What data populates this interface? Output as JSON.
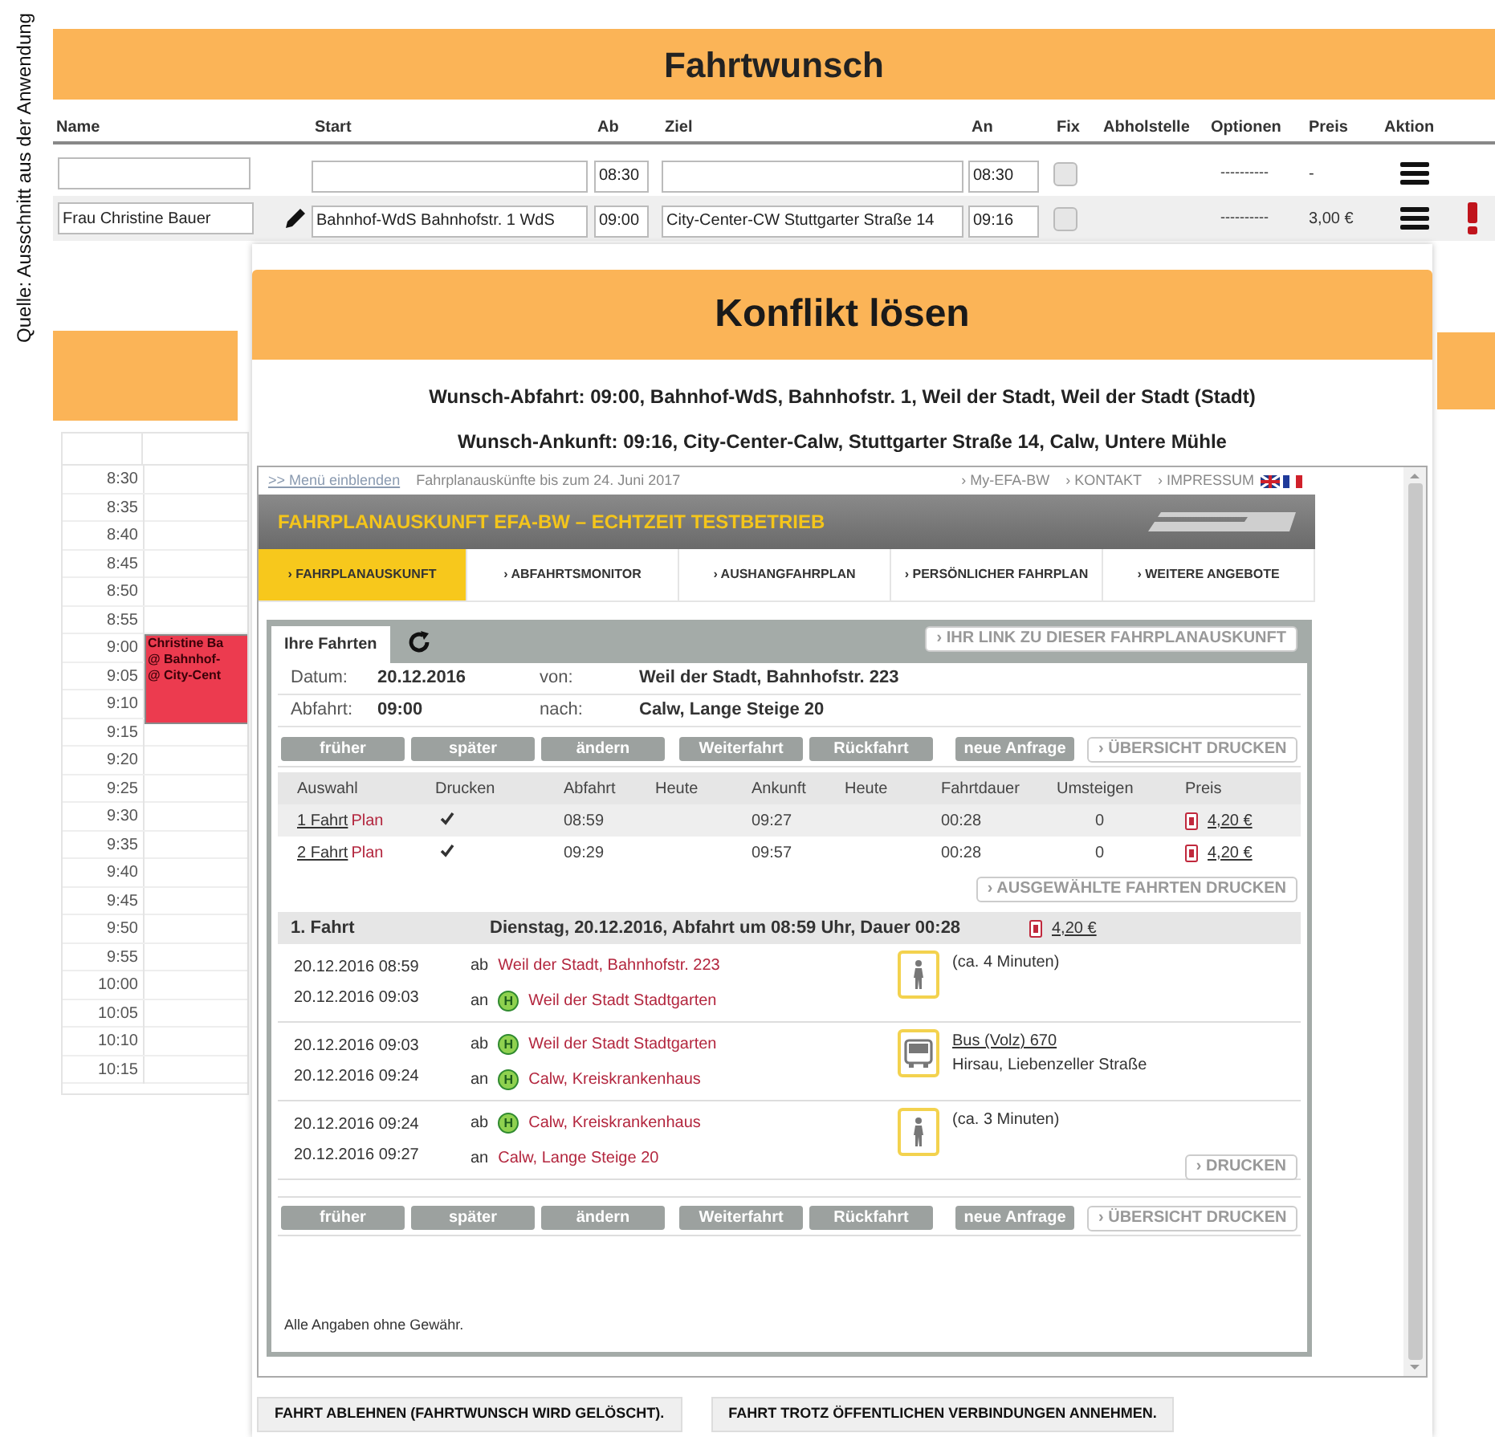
{
  "source_note": "Quelle: Ausschnitt aus der Anwendung",
  "request": {
    "title": "Fahrtwunsch",
    "columns": [
      "Name",
      "Start",
      "Ab",
      "Ziel",
      "An",
      "Fix",
      "Abholstelle",
      "Optionen",
      "Preis",
      "Aktion"
    ],
    "rows": [
      {
        "ab": "08:30",
        "an": "08:30",
        "fix": false,
        "options": "----------",
        "price": "-",
        "editable": false,
        "conflict": false
      },
      {
        "name": "Frau Christine Bauer",
        "start": "Bahnhof-WdS Bahnhofstr. 1 WdS",
        "ab": "09:00",
        "ziel": "City-Center-CW Stuttgarter Straße 14",
        "an": "09:16",
        "fix": false,
        "options": "----------",
        "price": "3,00 €",
        "editable": true,
        "conflict": true
      }
    ]
  },
  "calendar": {
    "slots": [
      {
        "time": "8:30"
      },
      {
        "time": "8:35"
      },
      {
        "time": "8:40"
      },
      {
        "time": "8:45"
      },
      {
        "time": "8:50"
      },
      {
        "time": "8:55"
      },
      {
        "time": "9:00",
        "event": {
          "lines": [
            "Christine Ba",
            "@ Bahnhof-",
            "@ City-Cent"
          ]
        }
      },
      {
        "time": "9:05"
      },
      {
        "time": "9:10"
      },
      {
        "time": "9:15"
      },
      {
        "time": "9:20"
      },
      {
        "time": "9:25"
      },
      {
        "time": "9:30"
      },
      {
        "time": "9:35"
      },
      {
        "time": "9:40"
      },
      {
        "time": "9:45"
      },
      {
        "time": "9:50"
      },
      {
        "time": "9:55"
      },
      {
        "time": "10:00"
      },
      {
        "time": "10:05"
      },
      {
        "time": "10:10"
      },
      {
        "time": "10:15"
      }
    ]
  },
  "dialog": {
    "title": "Konflikt lösen",
    "lines": [
      "Wunsch-Abfahrt: 09:00, Bahnhof-WdS, Bahnhofstr. 1, Weil der Stadt, Weil der Stadt (Stadt)",
      "Wunsch-Ankunft: 09:16, City-Center-Calw, Stuttgarter Straße 14, Calw, Untere Mühle"
    ],
    "efa": {
      "menu_link": ">> Menü einblenden",
      "notice": "Fahrplanauskünfte bis zum 24. Juni 2017",
      "top_links": [
        "› My-EFA-BW",
        "› KONTAKT",
        "› IMPRESSUM"
      ],
      "banner": "FAHRPLANAUSKUNFT EFA-BW – ECHTZEIT TESTBETRIEB",
      "nav": [
        {
          "label": "› FAHRPLANAUSKUNFT",
          "selected": true
        },
        {
          "label": "› ABFAHRTSMONITOR",
          "selected": false
        },
        {
          "label": "› AUSHANGFAHRPLAN",
          "selected": false
        },
        {
          "label": "› PERSÖNLICHER FAHRPLAN",
          "selected": false
        },
        {
          "label": "› WEITERE ANGEBOTE",
          "selected": false
        }
      ],
      "panel_tab": "Ihre Fahrten",
      "link_button": "› IHR LINK ZU DIESER FAHRPLANAUSKUNFT",
      "query": [
        {
          "label": "Datum:",
          "value": "20.12.2016",
          "label2": "von:",
          "value2": "Weil der Stadt, Bahnhofstr. 223"
        },
        {
          "label": "Abfahrt:",
          "value": "09:00",
          "label2": "nach:",
          "value2": "Calw, Lange Steige 20"
        }
      ],
      "toolbar_top": {
        "buttons": [
          "früher",
          "später",
          "ändern",
          "Weiterfahrt",
          "Rückfahrt",
          "neue Anfrage"
        ],
        "print": "› ÜBERSICHT DRUCKEN"
      },
      "results": {
        "columns": [
          "Auswahl",
          "Drucken",
          "Abfahrt",
          "Heute",
          "Ankunft",
          "Heute",
          "Fahrtdauer",
          "Umsteigen",
          "Preis"
        ],
        "rows": [
          {
            "trip": "1 Fahrt",
            "plan": "Plan",
            "print": true,
            "dep": "08:59",
            "arr": "09:27",
            "duration": "00:28",
            "changes": "0",
            "price": "4,20 €",
            "selected": true
          },
          {
            "trip": "2 Fahrt",
            "plan": "Plan",
            "print": true,
            "dep": "09:29",
            "arr": "09:57",
            "duration": "00:28",
            "changes": "0",
            "price": "4,20 €",
            "selected": false
          }
        ]
      },
      "print_selected": "› AUSGEWÄHLTE FAHRTEN DRUCKEN",
      "detail": {
        "title": "1. Fahrt",
        "summary": "Dienstag, 20.12.2016, Abfahrt um 08:59 Uhr, Dauer 00:28",
        "price": "4,20 €",
        "legs": [
          {
            "dep_time": "20.12.2016 08:59",
            "arr_time": "20.12.2016 09:03",
            "from": {
              "prefix": "ab",
              "name": "Weil der Stadt, Bahnhofstr. 223"
            },
            "to": {
              "prefix": "an",
              "badge": "H",
              "name": "Weil der Stadt Stadtgarten"
            },
            "kind": "walk",
            "info": [
              "(ca. 4 Minuten)"
            ]
          },
          {
            "dep_time": "20.12.2016 09:03",
            "arr_time": "20.12.2016 09:24",
            "from": {
              "prefix": "ab",
              "badge": "H",
              "name": "Weil der Stadt Stadtgarten"
            },
            "to": {
              "prefix": "an",
              "badge": "H",
              "name": "Calw, Kreiskrankenhaus"
            },
            "kind": "bus",
            "line": "Bus (Volz) 670",
            "info": [
              "Hirsau, Liebenzeller Straße"
            ]
          },
          {
            "dep_time": "20.12.2016 09:24",
            "arr_time": "20.12.2016 09:27",
            "from": {
              "prefix": "ab",
              "badge": "H",
              "name": "Calw, Kreiskrankenhaus"
            },
            "to": {
              "prefix": "an",
              "name": "Calw, Lange Steige 20"
            },
            "kind": "walk",
            "info": [
              "(ca. 3 Minuten)"
            ]
          }
        ],
        "print": "› DRUCKEN"
      },
      "toolbar_bottom": {
        "buttons": [
          "früher",
          "später",
          "ändern",
          "Weiterfahrt",
          "Rückfahrt",
          "neue Anfrage"
        ],
        "print": "› ÜBERSICHT DRUCKEN"
      },
      "disclaimer": "Alle Angaben ohne Gewähr."
    },
    "actions": [
      "FAHRT ABLEHNEN (FAHRTWUNSCH WIRD GELÖSCHT).",
      "FAHRT TROTZ ÖFFENTLICHEN VERBINDUNGEN ANNEHMEN."
    ]
  }
}
